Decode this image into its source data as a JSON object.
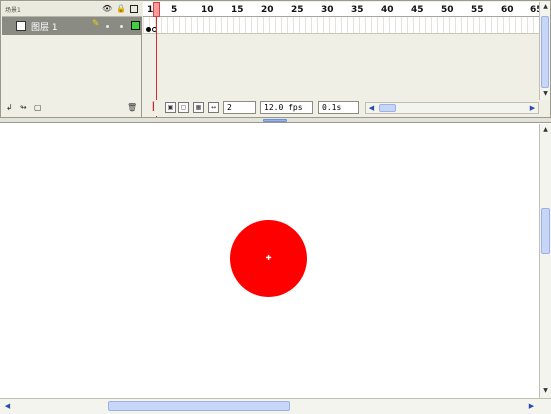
{
  "timeline": {
    "scene_label": "场景1",
    "layer": {
      "name": "图层 1"
    },
    "ruler_labels": [
      "1",
      "5",
      "10",
      "15",
      "20",
      "25",
      "30",
      "35",
      "40",
      "45",
      "50",
      "55",
      "60",
      "65"
    ],
    "status": {
      "current_frame": "2",
      "frame_rate": "12.0 fps",
      "elapsed_time": "0.1s"
    }
  },
  "stage": {
    "shape": {
      "type": "circle",
      "fill": "#FF0000"
    }
  },
  "colors": {
    "layer_selected_bg": "#8A8B83",
    "outline_box": "#3FD23F",
    "playhead": "#FF9A9A",
    "scroll_thumb": "#C7D6F6"
  }
}
